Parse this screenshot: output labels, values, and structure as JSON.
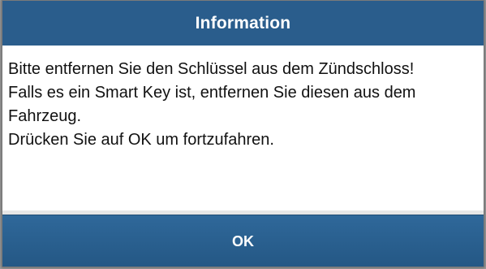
{
  "dialog": {
    "title": "Information",
    "message_lines": [
      "Bitte entfernen Sie den Schlüssel aus dem Zündschloss!",
      "Falls es ein Smart Key ist, entfernen Sie diesen aus dem",
      "Fahrzeug.",
      "Drücken Sie auf OK um fortzufahren."
    ],
    "ok_label": "OK"
  },
  "colors": {
    "title_bar": "#2a5d8c",
    "button": "#2a5f8e",
    "text": "#111111",
    "backdrop": "#9a9a9a"
  }
}
